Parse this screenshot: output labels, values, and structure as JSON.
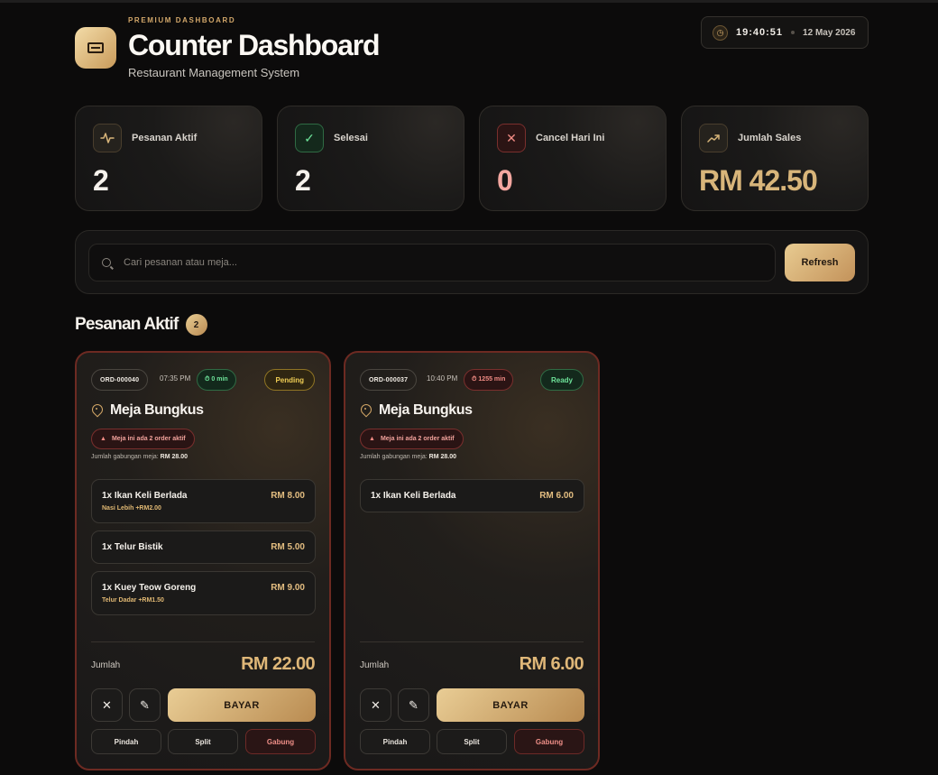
{
  "header": {
    "kicker": "PREMIUM DASHBOARD",
    "title": "Counter Dashboard",
    "subtitle": "Restaurant Management System",
    "icon": "register-icon",
    "time": "19:40:51",
    "date": "12 May 2026"
  },
  "stats": [
    {
      "label": "Pesanan Aktif",
      "value": "2",
      "icon": "activity-icon",
      "color": "#f6f2ec"
    },
    {
      "label": "Selesai",
      "value": "2",
      "icon": "check-icon",
      "color": "#f6f2ec"
    },
    {
      "label": "Cancel Hari Ini",
      "value": "0",
      "icon": "x-icon",
      "color": "#f4a7a0"
    },
    {
      "label": "Jumlah Sales",
      "value": "RM 42.50",
      "icon": "trending-up-icon",
      "color": "#d8b57a"
    }
  ],
  "search": {
    "placeholder": "Cari pesanan atau meja...",
    "value": "",
    "refresh_label": "Refresh"
  },
  "section": {
    "title": "Pesanan Aktif",
    "count": "2"
  },
  "orders": [
    {
      "id": "ORD-000040",
      "time": "07:35 PM",
      "timer": "⏱ 0 min",
      "status": "Pending",
      "table": "Meja Bungkus",
      "warning": "Meja ini ada 2 order aktif",
      "combined_label": "Jumlah gabungan meja:",
      "combined_value": "RM 28.00",
      "items": [
        {
          "name": "1x Ikan Keli Berlada",
          "price": "RM 8.00",
          "note": "Nasi Lebih +RM2.00"
        },
        {
          "name": "1x Telur Bistik",
          "price": "RM 5.00",
          "note": ""
        },
        {
          "name": "1x Kuey Teow Goreng",
          "price": "RM 9.00",
          "note": "Telur Dadar +RM1.50"
        }
      ],
      "total_label": "Jumlah",
      "total": "RM 22.00",
      "pay_label": "BAYAR",
      "move_label": "Pindah",
      "split_label": "Split",
      "merge_label": "Gabung"
    },
    {
      "id": "ORD-000037",
      "time": "10:40 PM",
      "timer": "⏱ 1255 min",
      "status": "Ready",
      "table": "Meja Bungkus",
      "warning": "Meja ini ada 2 order aktif",
      "combined_label": "Jumlah gabungan meja:",
      "combined_value": "RM 28.00",
      "items": [
        {
          "name": "1x Ikan Keli Berlada",
          "price": "RM 6.00",
          "note": ""
        }
      ],
      "total_label": "Jumlah",
      "total": "RM 6.00",
      "pay_label": "BAYAR",
      "move_label": "Pindah",
      "split_label": "Split",
      "merge_label": "Gabung"
    }
  ]
}
